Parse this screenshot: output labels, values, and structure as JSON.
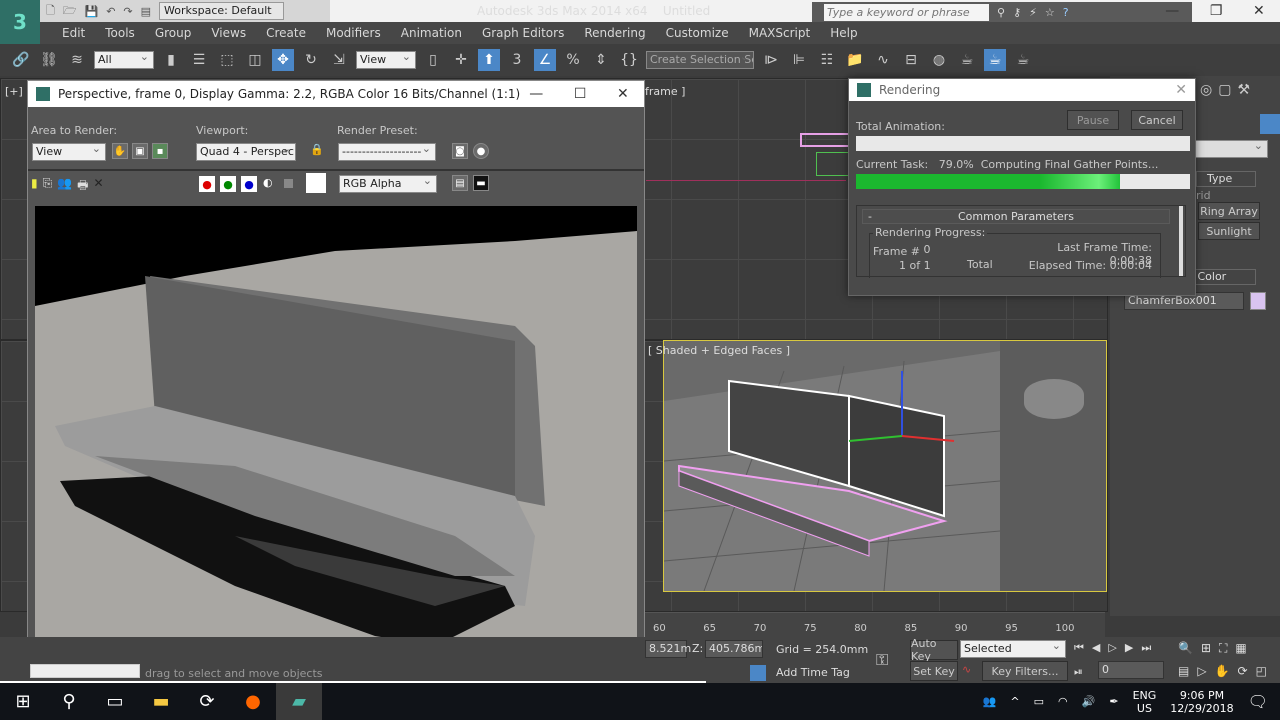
{
  "app": {
    "title": "Autodesk 3ds Max 2014 x64",
    "document": "Untitled",
    "workspace": "Workspace: Default",
    "search_placeholder": "Type a keyword or phrase"
  },
  "menu": [
    "Edit",
    "Tools",
    "Group",
    "Views",
    "Create",
    "Modifiers",
    "Animation",
    "Graph Editors",
    "Rendering",
    "Customize",
    "MAXScript",
    "Help"
  ],
  "toolbar": {
    "selection_filter": "All",
    "ref_coord": "View",
    "named_selection": "Create Selection Se",
    "snap_label": "3"
  },
  "viewports": {
    "top_right_label": "frame ]",
    "bottom_right_label": "[ Shaded + Edged Faces ]",
    "left_plus": "[+]",
    "left_plus2": "[+]"
  },
  "render_frame": {
    "title": "Perspective, frame 0, Display Gamma: 2.2, RGBA Color 16 Bits/Channel (1:1)",
    "area_label": "Area to Render:",
    "area_value": "View",
    "viewport_label": "Viewport:",
    "viewport_value": "Quad 4 - Perspec",
    "preset_label": "Render Preset:",
    "preset_value": "--------------------",
    "channel_value": "RGB Alpha"
  },
  "rendering_dialog": {
    "title": "Rendering",
    "pause": "Pause",
    "cancel": "Cancel",
    "total_animation_label": "Total Animation:",
    "total_progress": 0,
    "current_task_label": "Current Task:",
    "current_task_percent": "79.0%",
    "current_task_text": "Computing Final Gather Points...",
    "current_progress": 79.0,
    "rollout_toggle": "-",
    "rollout_title": "Common Parameters",
    "group_label": "Rendering Progress:",
    "frame_label": "Frame #",
    "frame_value": "0",
    "of_text": "1 of 1",
    "total_label": "Total",
    "last_frame_label": "Last Frame Time:",
    "last_frame_value": "0:00:38",
    "elapsed_label": "Elapsed Time:",
    "elapsed_value": "0:00:04"
  },
  "command_panel": {
    "type_label": "Type",
    "grid_partial": "rid",
    "ring_array": "Ring Array",
    "sunlight": "Sunlight",
    "color_label": "d Color",
    "object_name": "ChamferBox001",
    "object_color": "#d9c4f0"
  },
  "timeline": {
    "ticks": [
      "60",
      "65",
      "70",
      "75",
      "80",
      "85",
      "90",
      "95",
      "100"
    ]
  },
  "status": {
    "x_partial": "8.521m",
    "z_label": "Z:",
    "z_value": "405.786mr",
    "grid": "Grid = 254.0mm",
    "add_time_tag": "Add Time Tag",
    "auto_key": "Auto Key",
    "set_key": "Set Key",
    "key_mode": "Selected",
    "key_filters": "Key Filters...",
    "frame": "0",
    "prompt": "drag to select and move objects"
  },
  "taskbar": {
    "lang": "ENG",
    "region": "US",
    "time": "9:06 PM",
    "date": "12/29/2018"
  },
  "colors": {
    "progress": "#22c33a",
    "accent": "#4b87c7"
  }
}
